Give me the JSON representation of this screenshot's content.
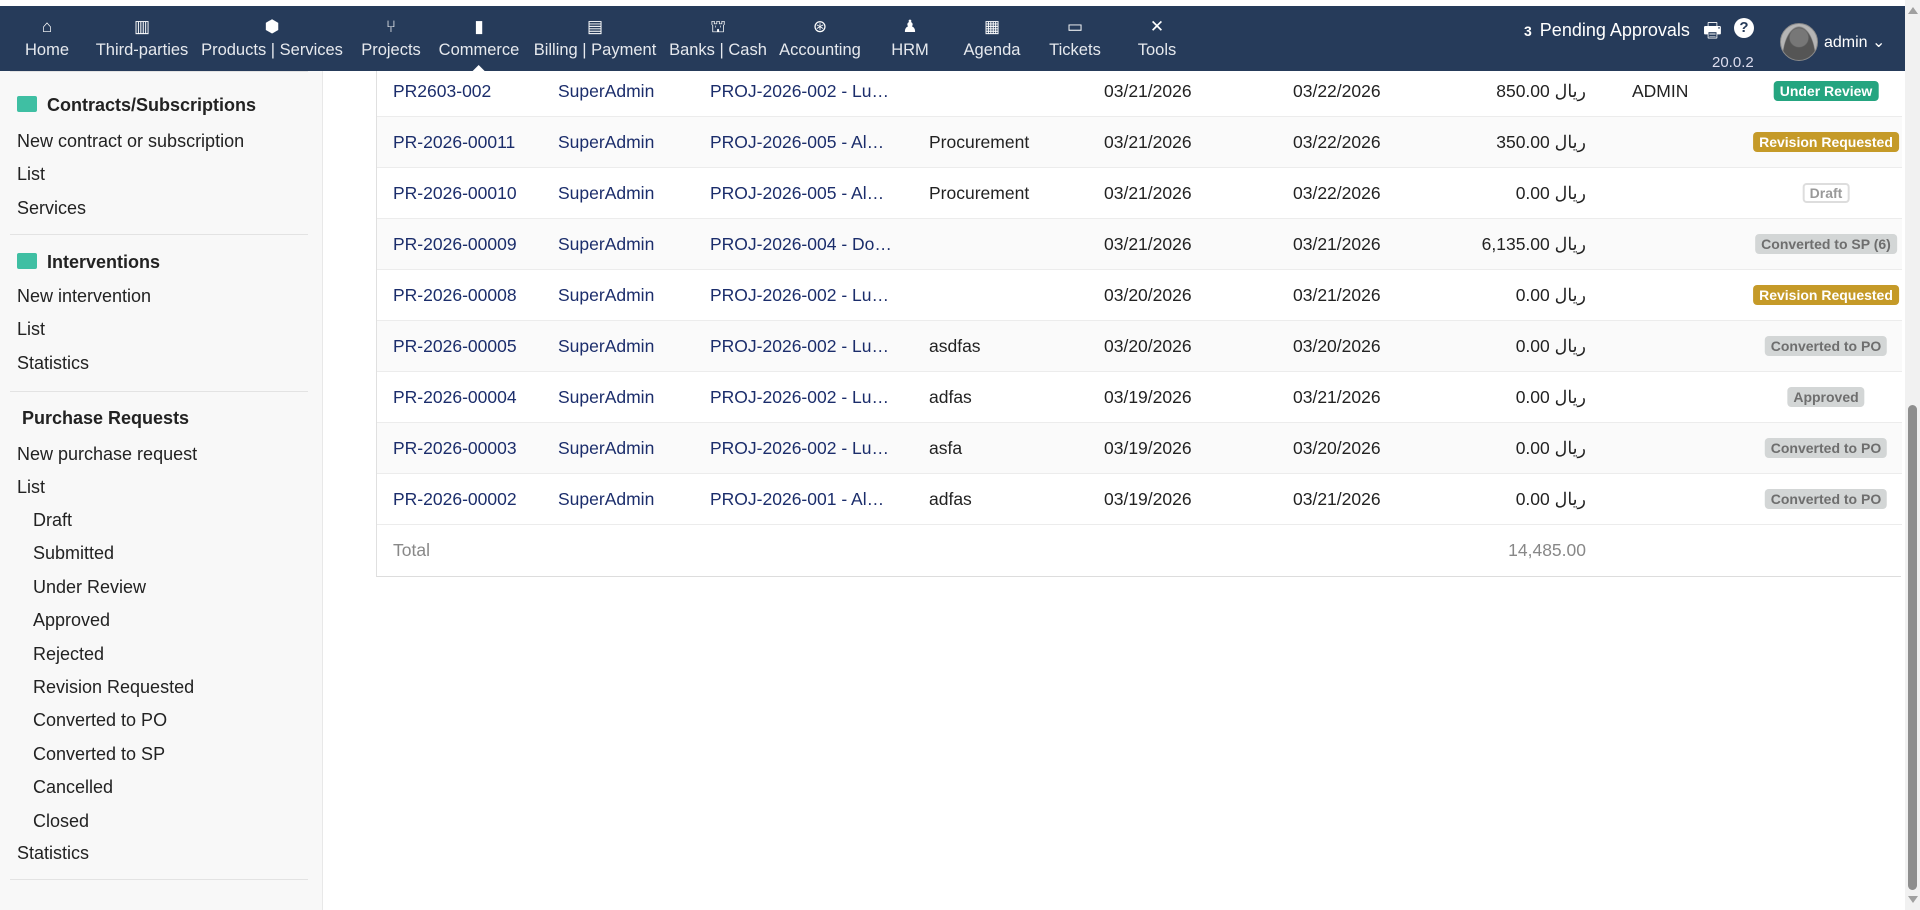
{
  "nav": {
    "items": [
      {
        "label": "Home",
        "icon": "⌂"
      },
      {
        "label": "Third-parties",
        "icon": "▥"
      },
      {
        "label": "Products | Services",
        "icon": "⬢"
      },
      {
        "label": "Projects",
        "icon": "⑂"
      },
      {
        "label": "Commerce",
        "icon": "▮"
      },
      {
        "label": "Billing | Payment",
        "icon": "▤"
      },
      {
        "label": "Banks | Cash",
        "icon": "⛫"
      },
      {
        "label": "Accounting",
        "icon": "⊛"
      },
      {
        "label": "HRM",
        "icon": "♟"
      },
      {
        "label": "Agenda",
        "icon": "▦"
      },
      {
        "label": "Tickets",
        "icon": "▭"
      },
      {
        "label": "Tools",
        "icon": "✕"
      }
    ],
    "pending_count": "3",
    "pending_label": "Pending Approvals",
    "version": "20.0.2",
    "user": "admin"
  },
  "sidebar": {
    "contracts": {
      "title": "Contracts/Subscriptions",
      "items": [
        "New contract or subscription",
        "List",
        "Services"
      ]
    },
    "interventions": {
      "title": "Interventions",
      "items": [
        "New intervention",
        "List",
        "Statistics"
      ]
    },
    "purchase": {
      "title": "Purchase Requests",
      "items": [
        "New purchase request",
        "List"
      ],
      "sub": [
        "Draft",
        "Submitted",
        "Under Review",
        "Approved",
        "Rejected",
        "Revision Requested",
        "Converted to PO",
        "Converted to SP",
        "Cancelled",
        "Closed"
      ],
      "footer": "Statistics"
    }
  },
  "table": {
    "rows": [
      {
        "ref": "PR2603-002",
        "user": "SuperAdmin",
        "project": "PROJ-2026-002 - Lu…",
        "label": "",
        "date": "03/21/2026",
        "date2": "03/22/2026",
        "amount": "850.00 ريال",
        "approver": "ADMIN",
        "status": "Under Review",
        "style": "green"
      },
      {
        "ref": "PR-2026-00011",
        "user": "SuperAdmin",
        "project": "PROJ-2026-005 - Al…",
        "label": "Procurement",
        "date": "03/21/2026",
        "date2": "03/22/2026",
        "amount": "350.00 ريال",
        "approver": "",
        "status": "Revision Requested",
        "style": "gold"
      },
      {
        "ref": "PR-2026-00010",
        "user": "SuperAdmin",
        "project": "PROJ-2026-005 - Al…",
        "label": "Procurement",
        "date": "03/21/2026",
        "date2": "03/22/2026",
        "amount": "0.00 ريال",
        "approver": "",
        "status": "Draft",
        "style": "draft"
      },
      {
        "ref": "PR-2026-00009",
        "user": "SuperAdmin",
        "project": "PROJ-2026-004 - Do…",
        "label": "",
        "date": "03/21/2026",
        "date2": "03/21/2026",
        "amount": "6,135.00 ريال",
        "approver": "",
        "status": "Converted to SP (6)",
        "style": "gray"
      },
      {
        "ref": "PR-2026-00008",
        "user": "SuperAdmin",
        "project": "PROJ-2026-002 - Lu…",
        "label": "",
        "date": "03/20/2026",
        "date2": "03/21/2026",
        "amount": "0.00 ريال",
        "approver": "",
        "status": "Revision Requested",
        "style": "gold"
      },
      {
        "ref": "PR-2026-00005",
        "user": "SuperAdmin",
        "project": "PROJ-2026-002 - Lu…",
        "label": "asdfas",
        "date": "03/20/2026",
        "date2": "03/20/2026",
        "amount": "0.00 ريال",
        "approver": "",
        "status": "Converted to PO",
        "style": "gray"
      },
      {
        "ref": "PR-2026-00004",
        "user": "SuperAdmin",
        "project": "PROJ-2026-002 - Lu…",
        "label": "adfas",
        "date": "03/19/2026",
        "date2": "03/21/2026",
        "amount": "0.00 ريال",
        "approver": "",
        "status": "Approved",
        "style": "gray"
      },
      {
        "ref": "PR-2026-00003",
        "user": "SuperAdmin",
        "project": "PROJ-2026-002 - Lu…",
        "label": "asfa",
        "date": "03/19/2026",
        "date2": "03/20/2026",
        "amount": "0.00 ريال",
        "approver": "",
        "status": "Converted to PO",
        "style": "gray"
      },
      {
        "ref": "PR-2026-00002",
        "user": "SuperAdmin",
        "project": "PROJ-2026-001 - Al…",
        "label": "adfas",
        "date": "03/19/2026",
        "date2": "03/21/2026",
        "amount": "0.00 ريال",
        "approver": "",
        "status": "Converted to PO",
        "style": "gray"
      }
    ],
    "total_label": "Total",
    "total_value": "14,485.00"
  }
}
